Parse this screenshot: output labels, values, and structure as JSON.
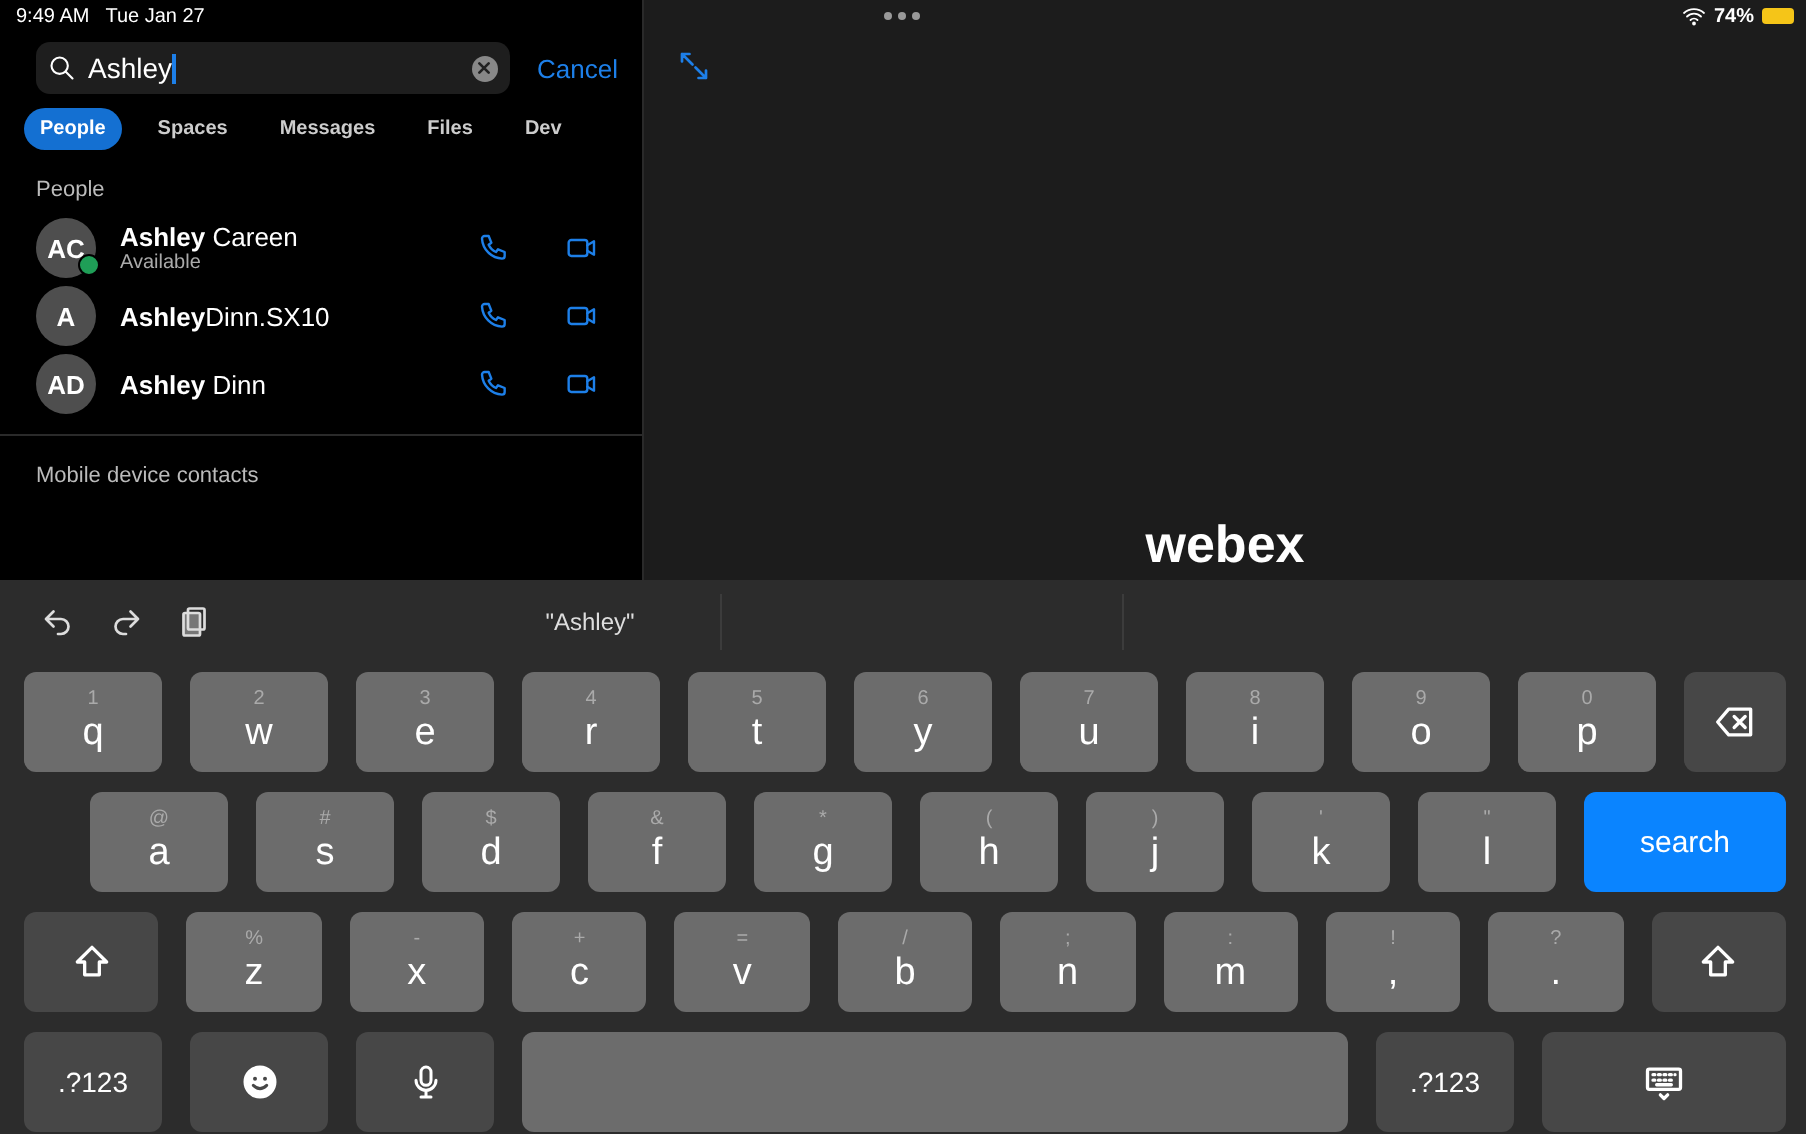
{
  "status_bar": {
    "time": "9:49 AM",
    "date": "Tue Jan 27",
    "battery": "74%"
  },
  "search": {
    "value": "Ashley",
    "cancel": "Cancel"
  },
  "tabs": [
    {
      "label": "People",
      "selected": true
    },
    {
      "label": "Spaces",
      "selected": false
    },
    {
      "label": "Messages",
      "selected": false
    },
    {
      "label": "Files",
      "selected": false
    },
    {
      "label": "Dev",
      "selected": false
    }
  ],
  "people_section": {
    "title": "People",
    "contacts": [
      {
        "initials": "AC",
        "name": "**Ashley** Careen",
        "status": "Available",
        "online": true
      },
      {
        "initials": "A",
        "name": "**Ashley**Dinn.SX10",
        "online": false
      },
      {
        "initials": "AD",
        "name": "**Ashley** Dinn",
        "online": false
      }
    ]
  },
  "mobile_section": {
    "title": "Mobile device contacts"
  },
  "main": {
    "logo": "webex"
  },
  "keyboard": {
    "suggestion": "\"Ashley\"",
    "rows": [
      [
        {
          "kind": "char",
          "label": "q",
          "hint": "1"
        },
        {
          "kind": "char",
          "label": "w",
          "hint": "2"
        },
        {
          "kind": "char",
          "label": "e",
          "hint": "3"
        },
        {
          "kind": "char",
          "label": "r",
          "hint": "4"
        },
        {
          "kind": "char",
          "label": "t",
          "hint": "5"
        },
        {
          "kind": "char",
          "label": "y",
          "hint": "6"
        },
        {
          "kind": "char",
          "label": "u",
          "hint": "7"
        },
        {
          "kind": "char",
          "label": "i",
          "hint": "8"
        },
        {
          "kind": "char",
          "label": "o",
          "hint": "9"
        },
        {
          "kind": "char",
          "label": "p",
          "hint": "0"
        },
        {
          "kind": "backspace"
        }
      ],
      [
        {
          "kind": "char",
          "label": "a",
          "hint": "@"
        },
        {
          "kind": "char",
          "label": "s",
          "hint": "#"
        },
        {
          "kind": "char",
          "label": "d",
          "hint": "$"
        },
        {
          "kind": "char",
          "label": "f",
          "hint": "&"
        },
        {
          "kind": "char",
          "label": "g",
          "hint": "*"
        },
        {
          "kind": "char",
          "label": "h",
          "hint": "("
        },
        {
          "kind": "char",
          "label": "j",
          "hint": ")"
        },
        {
          "kind": "char",
          "label": "k",
          "hint": "'"
        },
        {
          "kind": "char",
          "label": "l",
          "hint": "\""
        },
        {
          "kind": "action",
          "label": "search"
        }
      ],
      [
        {
          "kind": "shift"
        },
        {
          "kind": "char",
          "label": "z",
          "hint": "%"
        },
        {
          "kind": "char",
          "label": "x",
          "hint": "-"
        },
        {
          "kind": "char",
          "label": "c",
          "hint": "+"
        },
        {
          "kind": "char",
          "label": "v",
          "hint": "="
        },
        {
          "kind": "char",
          "label": "b",
          "hint": "/"
        },
        {
          "kind": "char",
          "label": "n",
          "hint": ";"
        },
        {
          "kind": "char",
          "label": "m",
          "hint": ":"
        },
        {
          "kind": "char",
          "label": ",",
          "hint": "!"
        },
        {
          "kind": "char",
          "label": ".",
          "hint": "?"
        },
        {
          "kind": "shift"
        }
      ],
      [
        {
          "kind": "mode",
          "label": ".?123"
        },
        {
          "kind": "emoji"
        },
        {
          "kind": "mic"
        },
        {
          "kind": "space"
        },
        {
          "kind": "mode",
          "label": ".?123"
        },
        {
          "kind": "hide"
        }
      ]
    ]
  }
}
